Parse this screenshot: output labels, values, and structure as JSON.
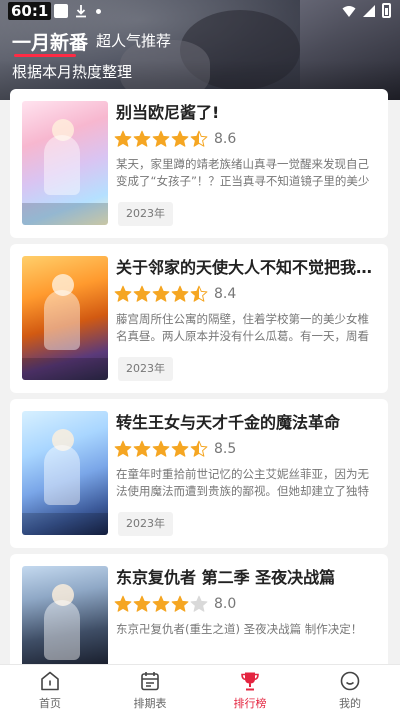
{
  "status_bar": {
    "time": "60:1"
  },
  "header": {
    "active_tab": "一月新番",
    "other_tab": "超人气推荐",
    "subtitle": "根据本月热度整理"
  },
  "colors": {
    "accent": "#e4243f",
    "star": "#f5a623",
    "star_empty": "#d9d9d9"
  },
  "anime_list": [
    {
      "title": "别当欧尼酱了!",
      "rating": "8.6",
      "stars": 4.5,
      "desc": "某天，家里蹲的靖老族绪山真寻一觉醒来发现自己变成了“女孩子”！？正当真寻不知道镜子里的美少女是自...",
      "year": "2023年"
    },
    {
      "title": "关于邻家的天使大人不知不觉把我惯成了废人这档子事",
      "rating": "8.4",
      "stars": 4.5,
      "desc": "藤宫周所住公寓的隔壁，住着学校第一的美少女椎名真昼。两人原本并没有什么瓜葛。有一天，周看到她...",
      "year": "2023年"
    },
    {
      "title": "转生王女与天才千金的魔法革命",
      "rating": "8.5",
      "stars": 4.5,
      "desc": "在童年时重拾前世记忆的公主艾妮丝菲亚，因为无法使用魔法而遭到贵族的鄙视。但她却建立了独特的...",
      "year": "2023年"
    },
    {
      "title": "东京复仇者 第二季 圣夜决战篇",
      "rating": "8.0",
      "stars": 4,
      "desc": "东京卍复仇者(重生之道) 圣夜决战篇 制作决定！",
      "year": ""
    }
  ],
  "bottom_nav": [
    {
      "label": "首页",
      "icon": "home-icon"
    },
    {
      "label": "排期表",
      "icon": "calendar-icon"
    },
    {
      "label": "排行榜",
      "icon": "trophy-icon",
      "active": true
    },
    {
      "label": "我的",
      "icon": "smiley-icon"
    }
  ]
}
